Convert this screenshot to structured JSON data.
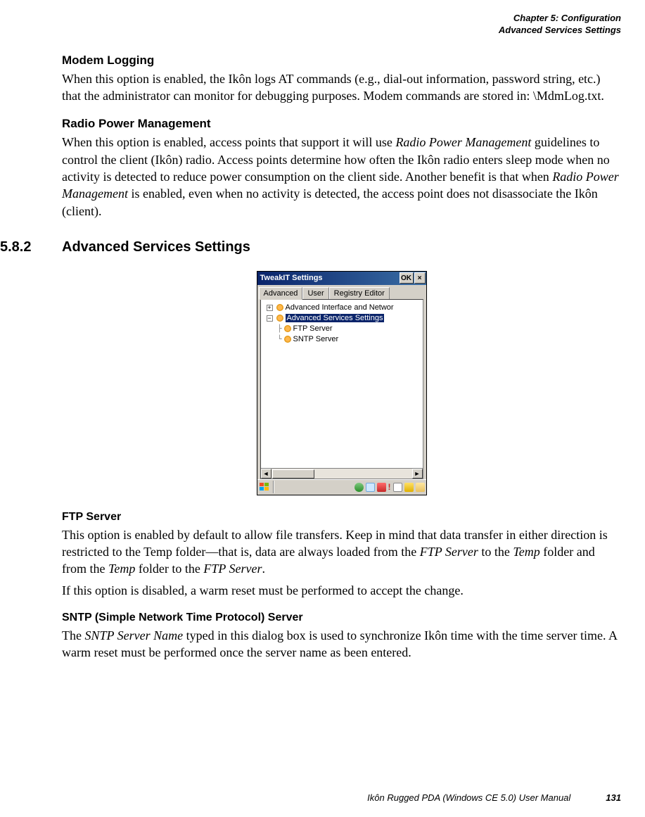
{
  "header": {
    "chapter": "Chapter 5:  Configuration",
    "section": "Advanced Services Settings"
  },
  "modem": {
    "heading": "Modem Logging",
    "body": "When this option is enabled, the Ikôn logs AT commands (e.g., dial-out information, password string, etc.) that the administrator can monitor for debugging purposes. Modem commands are stored in: \\MdmLog.txt."
  },
  "radio": {
    "heading": "Radio Power Management",
    "p1_a": "When this option is enabled, access points that support it will use ",
    "p1_i1": "Radio Power Management",
    "p1_b": " guidelines to control the client (Ikôn) radio. Access points determine how often the Ikôn radio enters sleep mode when no activity is detected to reduce power consumption on the client side. Another benefit is that when ",
    "p1_i2": "Radio Power Management",
    "p1_c": " is enabled, even when no activity is detected, the access point does not disassociate the Ikôn (client)."
  },
  "sec": {
    "num": "5.8.2",
    "title": "Advanced Services Settings"
  },
  "ss": {
    "title": "TweakIT Settings",
    "ok": "OK",
    "tabs": {
      "advanced": "Advanced",
      "user": "User",
      "registry": "Registry Editor"
    },
    "tree": {
      "n1": "Advanced Interface and Networ",
      "n2": "Advanced Services Settings",
      "n3": "FTP Server",
      "n4": "SNTP Server"
    }
  },
  "ftp": {
    "heading": "FTP Server",
    "p1_a": "This option is enabled by default to allow file transfers. Keep in mind that data transfer in either direction is restricted to the Temp folder—that is, data are always loaded from the ",
    "p1_i1": "FTP Server",
    "p1_b": " to the ",
    "p1_i2": "Temp",
    "p1_c": " folder and from the ",
    "p1_i3": "Temp",
    "p1_d": " folder to the ",
    "p1_i4": "FTP Server",
    "p1_e": ".",
    "p2": "If this option is disabled, a warm reset must be performed to accept the change."
  },
  "sntp": {
    "heading": "SNTP (Simple Network Time Protocol) Server",
    "p1_a": "The ",
    "p1_i1": "SNTP Server Name",
    "p1_b": " typed in this dialog box is used to synchronize Ikôn time with the time server time. A warm reset must be performed once the server name as been entered."
  },
  "footer": {
    "title": "Ikôn Rugged PDA (Windows CE 5.0) User Manual",
    "page": "131"
  }
}
